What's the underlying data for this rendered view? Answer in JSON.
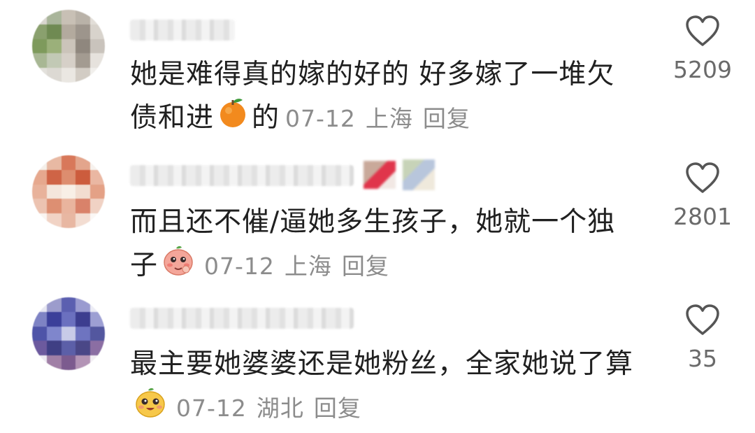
{
  "comments": [
    {
      "text": "她是难得真的嫁的好的 好多嫁了一堆欠债和进",
      "text_after_emoji": "的",
      "date": "07-12",
      "location": "上海",
      "reply_label": "回复",
      "likes": "5209",
      "emoji_icon": "orange-emoji-icon"
    },
    {
      "text": "而且还不催/逼她多生孩子，她就一个独子",
      "text_after_emoji": "",
      "date": "07-12",
      "location": "上海",
      "reply_label": "回复",
      "likes": "2801",
      "emoji_icon": "shy-face-emoji-icon"
    },
    {
      "text": "最主要她婆婆还是她粉丝，全家她说了算",
      "text_after_emoji": "",
      "date": "07-12",
      "location": "湖北",
      "reply_label": "回复",
      "likes": "35",
      "emoji_icon": "laughing-face-emoji-icon"
    }
  ],
  "colors": {
    "meta_gray": "#8c8c8c",
    "text": "#202020",
    "heart_stroke": "#555555"
  }
}
